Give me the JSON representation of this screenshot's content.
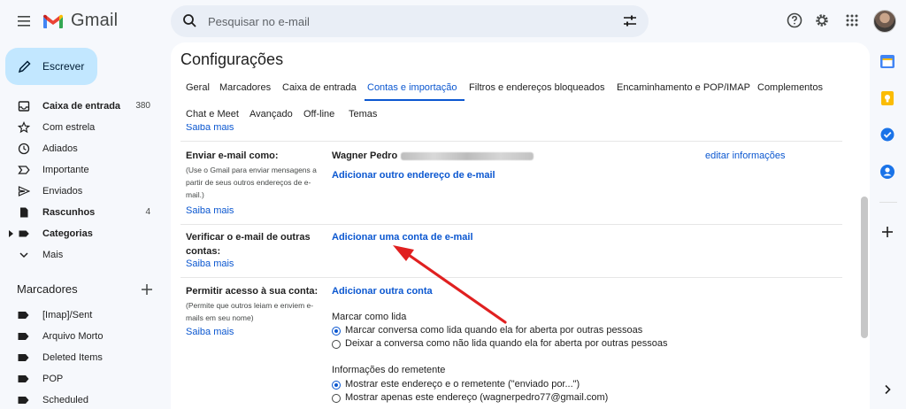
{
  "app": {
    "name": "Gmail"
  },
  "search": {
    "placeholder": "Pesquisar no e-mail"
  },
  "compose": {
    "label": "Escrever"
  },
  "nav": [
    {
      "label": "Caixa de entrada",
      "count": "380",
      "icon": "inbox-icon",
      "bold": true
    },
    {
      "label": "Com estrela",
      "count": "",
      "icon": "star-icon",
      "bold": false
    },
    {
      "label": "Adiados",
      "count": "",
      "icon": "clock-icon",
      "bold": false
    },
    {
      "label": "Importante",
      "count": "",
      "icon": "important-icon",
      "bold": false
    },
    {
      "label": "Enviados",
      "count": "",
      "icon": "send-icon",
      "bold": false
    },
    {
      "label": "Rascunhos",
      "count": "4",
      "icon": "draft-icon",
      "bold": true
    },
    {
      "label": "Categorias",
      "count": "",
      "icon": "label-icon",
      "bold": true
    },
    {
      "label": "Mais",
      "count": "",
      "icon": "chevron-down-icon",
      "bold": false
    }
  ],
  "labels": {
    "heading": "Marcadores",
    "items": [
      "[Imap]/Sent",
      "Arquivo Morto",
      "Deleted Items",
      "POP",
      "Scheduled"
    ]
  },
  "settings": {
    "title": "Configurações",
    "tabs": [
      "Geral",
      "Marcadores",
      "Caixa de entrada",
      "Contas e importação",
      "Filtros e endereços bloqueados",
      "Encaminhamento e POP/IMAP",
      "Complementos",
      "Chat e Meet",
      "Avançado",
      "Off-line",
      "Temas"
    ],
    "active_tab": "Contas e importação",
    "learn_more": "Saiba mais",
    "send_as": {
      "label": "Enviar e-mail como:",
      "hint": [
        "(Use o Gmail para enviar mensagens a",
        "partir de seus outros endereços de e-",
        "mail.)"
      ],
      "name": "Wagner Pedro",
      "edit_link": "editar informações",
      "add_link": "Adicionar outro endereço de e-mail"
    },
    "check_mail": {
      "label_lines": [
        "Verificar o e-mail de outras",
        "contas:"
      ],
      "add_link": "Adicionar uma conta de e-mail"
    },
    "grant_access": {
      "label": "Permitir acesso à sua conta:",
      "hint": [
        "(Permite que outros leiam e enviem e-",
        "mails em seu nome)"
      ],
      "add_link": "Adicionar outra conta",
      "mark_read_heading": "Marcar como lida",
      "mark_read_options": [
        {
          "label": "Marcar conversa como lida quando ela for aberta por outras pessoas",
          "checked": true
        },
        {
          "label": "Deixar a conversa como não lida quando ela for aberta por outras pessoas",
          "checked": false
        }
      ],
      "sender_info_heading": "Informações do remetente",
      "sender_info_options": [
        {
          "label": "Mostrar este endereço e o remetente (\"enviado por...\")",
          "checked": true
        },
        {
          "label": "Mostrar apenas este endereço (wagnerpedro77@gmail.com)",
          "checked": false
        }
      ]
    }
  },
  "colors": {
    "accent": "#0b57d0",
    "compose_bg": "#c2e7ff",
    "annotation_arrow": "#e02020"
  }
}
